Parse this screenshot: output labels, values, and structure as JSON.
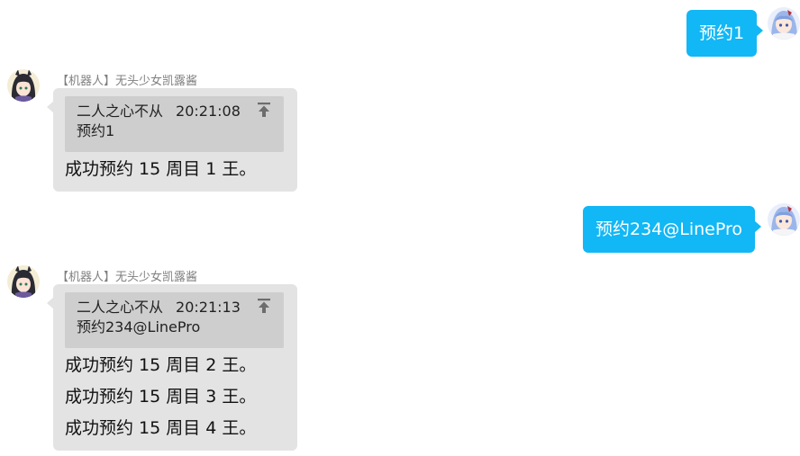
{
  "messages": [
    {
      "side": "user",
      "text": "预约1"
    },
    {
      "side": "bot",
      "sender": "【机器人】无头少女凯露酱",
      "quote": {
        "author": "二人之心不从",
        "time": "20:21:08",
        "text": "预约1"
      },
      "lines": [
        "成功预约 15 周目 1 王。"
      ]
    },
    {
      "side": "user",
      "text": "预约234@LinePro"
    },
    {
      "side": "bot",
      "sender": "【机器人】无头少女凯露酱",
      "quote": {
        "author": "二人之心不从",
        "time": "20:21:13",
        "text": "预约234@LinePro"
      },
      "lines": [
        "成功预约 15 周目 2 王。",
        "成功预约 15 周目 3 王。",
        "成功预约 15 周目 4 王。"
      ]
    }
  ],
  "colors": {
    "user_bubble": "#12b7f5",
    "bot_bubble": "#e3e3e3",
    "quote_bg": "#cecece"
  },
  "icons": {
    "user_avatar": "anime-girl-avatar-blue-hair",
    "bot_avatar": "anime-girl-avatar-black-hair",
    "quote_jump": "jump-to-top-icon"
  }
}
